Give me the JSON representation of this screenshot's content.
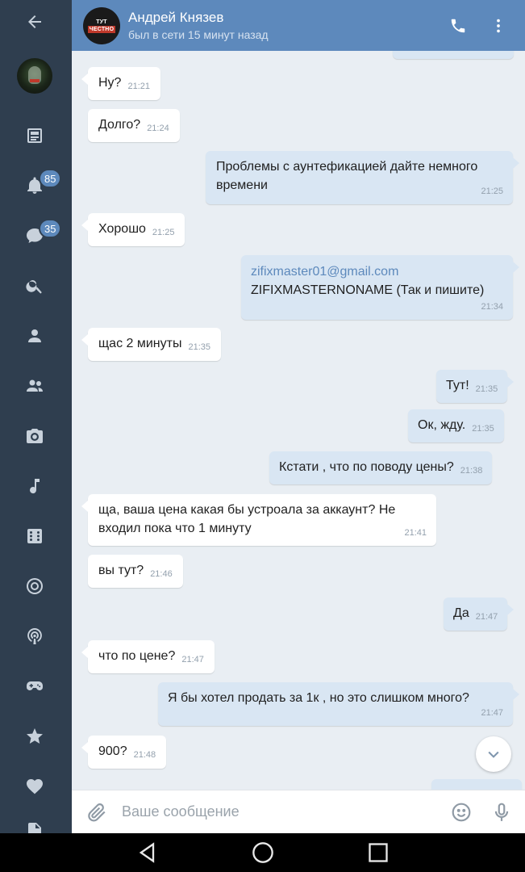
{
  "header": {
    "contact_name": "Андрей Князев",
    "status": "был в сети 15 минут назад",
    "avatar_logo_top": "ТУТ",
    "avatar_logo_bottom": "ЧЕСТНО"
  },
  "sidebar": {
    "items": [
      {
        "icon": "back-arrow-icon"
      },
      {
        "icon": "profile-avatar"
      },
      {
        "icon": "news-icon"
      },
      {
        "icon": "bell-icon",
        "badge": "85"
      },
      {
        "icon": "chat-icon",
        "badge": "35"
      },
      {
        "icon": "search-icon"
      },
      {
        "icon": "person-icon"
      },
      {
        "icon": "friends-icon"
      },
      {
        "icon": "camera-icon"
      },
      {
        "icon": "music-icon"
      },
      {
        "icon": "games-grid-icon"
      },
      {
        "icon": "target-icon"
      },
      {
        "icon": "podcast-icon"
      },
      {
        "icon": "gamepad-icon"
      },
      {
        "icon": "star-icon"
      },
      {
        "icon": "heart-icon"
      },
      {
        "icon": "document-icon"
      }
    ]
  },
  "messages": [
    {
      "dir": "in",
      "text": "Ну?",
      "time": "21:21"
    },
    {
      "dir": "in",
      "text": "Долго?",
      "time": "21:24"
    },
    {
      "dir": "out",
      "text": "Проблемы с аунтефикацией дайте немного времени",
      "time": "21:25"
    },
    {
      "dir": "in",
      "text": "Хорошо",
      "time": "21:25"
    },
    {
      "dir": "out",
      "link": "zifixmaster01@gmail.com",
      "text": "ZIFIXMASTERNONAME (Так и пишите)",
      "time": "21:34"
    },
    {
      "dir": "in",
      "text": "щас 2 минуты",
      "time": "21:35"
    },
    {
      "dir": "out",
      "text": "Тут!",
      "time": "21:35"
    },
    {
      "dir": "out",
      "text": "Ок, жду.",
      "time": "21:35"
    },
    {
      "dir": "out",
      "text": "Кстати , что по поводу цены?",
      "time": "21:38"
    },
    {
      "dir": "in",
      "text": "ща, ваша цена какая бы устроала за аккаунт? Не входил пока что 1 минуту",
      "time": "21:41"
    },
    {
      "dir": "in",
      "text": "вы тут?",
      "time": "21:46"
    },
    {
      "dir": "out",
      "text": "Да",
      "time": "21:47"
    },
    {
      "dir": "in",
      "text": "что по цене?",
      "time": "21:47"
    },
    {
      "dir": "out",
      "text": "Я бы хотел продать за 1к , но это слишком много?",
      "time": "21:47"
    },
    {
      "dir": "in",
      "text": "900?",
      "time": "21:48"
    }
  ],
  "input": {
    "placeholder": "Ваше сообщение"
  },
  "colors": {
    "accent": "#5d89bc",
    "sidebar": "#2f3e4f",
    "chat_bg": "#e9eef3",
    "incoming": "#ffffff",
    "outgoing": "#d9e6f3"
  }
}
